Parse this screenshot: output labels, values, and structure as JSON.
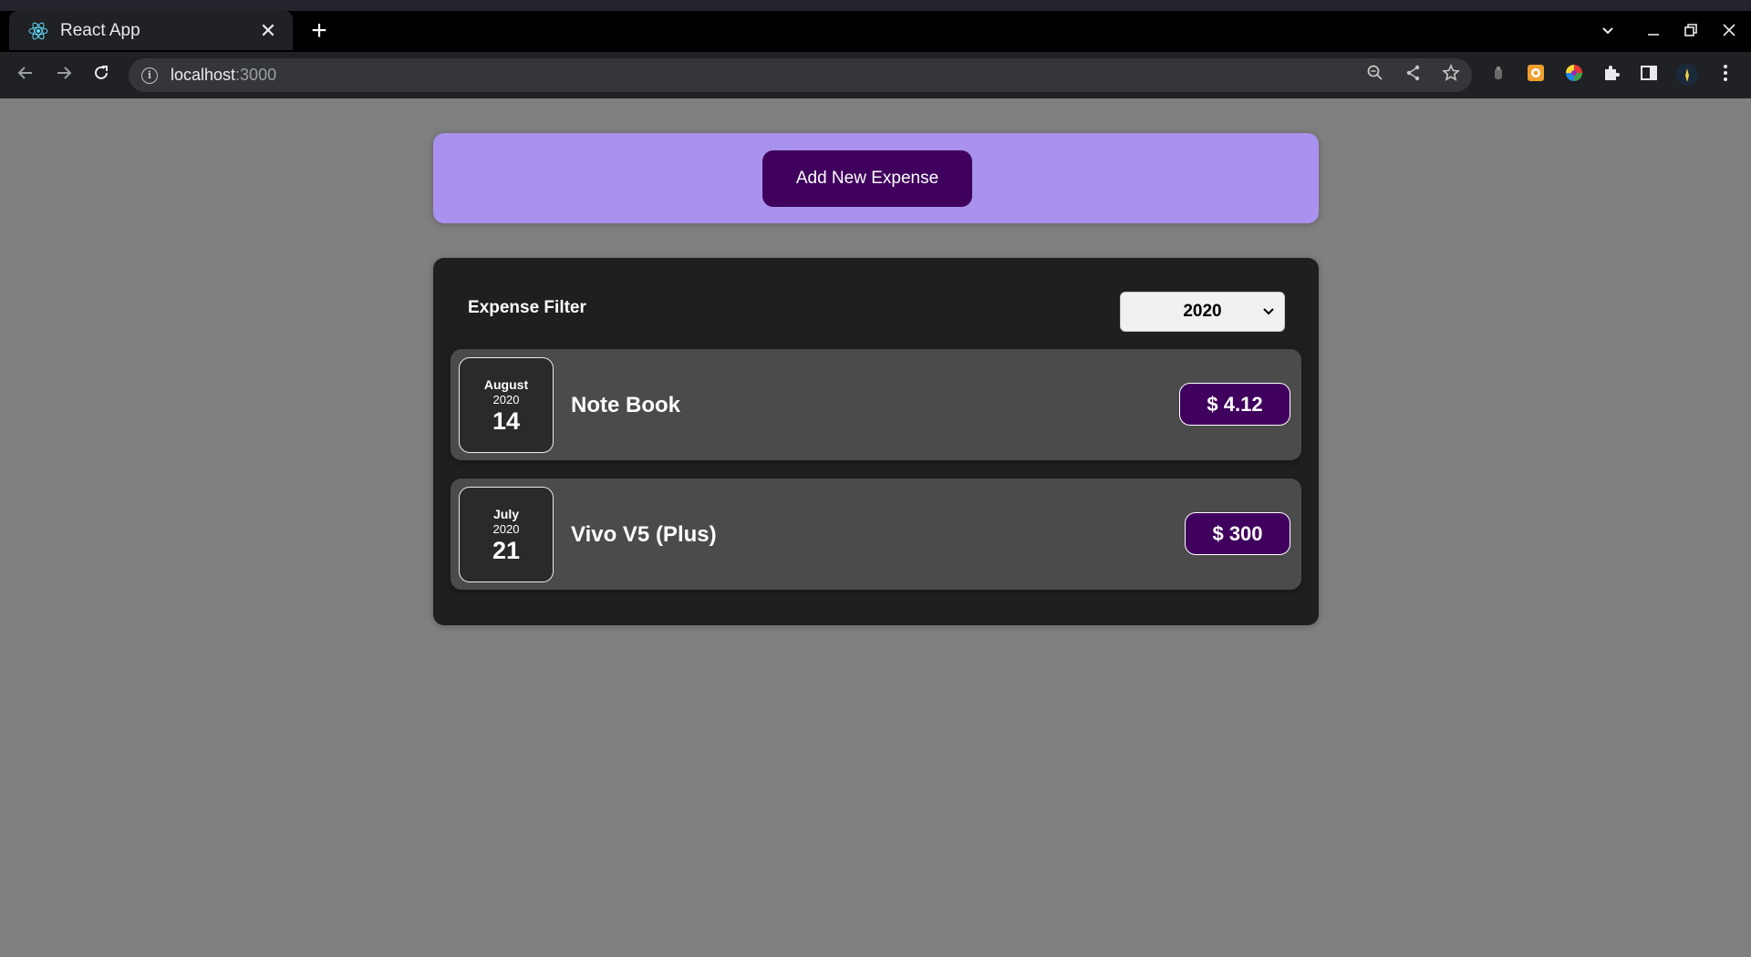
{
  "browser": {
    "tab_title": "React App",
    "tab_close": "✕",
    "new_tab": "+",
    "url_host": "localhost",
    "url_port": ":3000",
    "icons": [
      "react-favicon",
      "back-arrow-icon",
      "forward-arrow-icon",
      "reload-icon",
      "info-icon",
      "zoom-icon",
      "share-icon",
      "bookmark-star-icon",
      "extensions-puzzle-icon",
      "side-panel-icon",
      "profile-avatar",
      "menu-dots-icon"
    ]
  },
  "app": {
    "add_button_label": "Add New Expense",
    "filter": {
      "label": "Expense Filter",
      "selected_year": "2020"
    },
    "expenses": [
      {
        "month": "August",
        "year": "2020",
        "day": "14",
        "title": "Note Book",
        "amount": "$ 4.12"
      },
      {
        "month": "July",
        "year": "2020",
        "day": "21",
        "title": "Vivo V5 (Plus)",
        "amount": "$ 300"
      }
    ]
  },
  "colors": {
    "page_bg": "#808080",
    "new_expense_bg": "#a892ee",
    "button_purple": "#40005d",
    "panel_bg": "#1f1f1f",
    "item_bg": "#4b4b4b"
  }
}
